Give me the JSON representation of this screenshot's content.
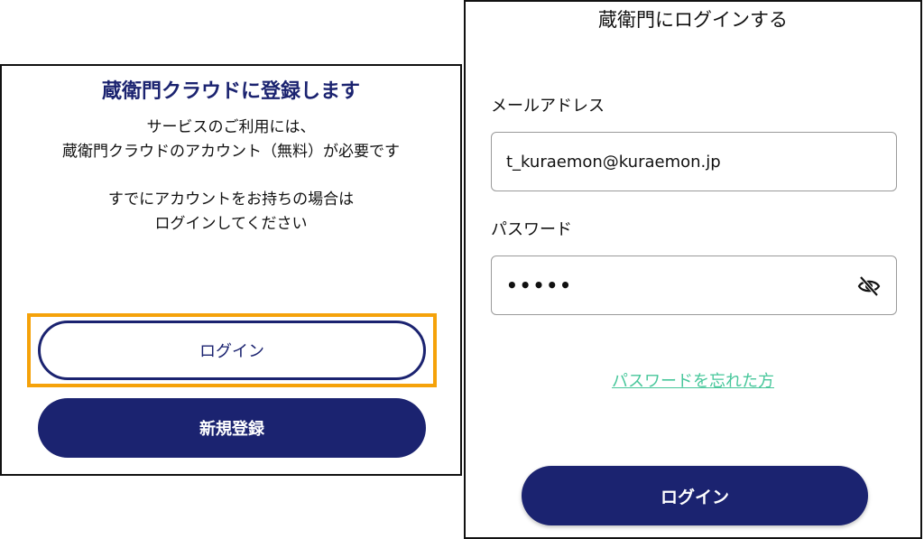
{
  "left_panel": {
    "title": "蔵衛門クラウドに登録します",
    "message_line1": "サービスのご利用には、",
    "message_line2": "蔵衛門クラウドのアカウント（無料）が必要です",
    "message_line3": "すでにアカウントをお持ちの場合は",
    "message_line4": "ログインしてください",
    "login_button": "ログイン",
    "register_button": "新規登録"
  },
  "right_panel": {
    "title": "蔵衛門にログインする",
    "email_label": "メールアドレス",
    "email_value": "t_kuraemon@kuraemon.jp",
    "password_label": "パスワード",
    "password_value": "•••••",
    "forgot_link": "パスワードを忘れた方",
    "login_button": "ログイン"
  },
  "colors": {
    "navy": "#1b2370",
    "highlight": "#f5a20a",
    "link": "#48c79b"
  },
  "icons": {
    "password_toggle": "eye-slash-icon"
  }
}
